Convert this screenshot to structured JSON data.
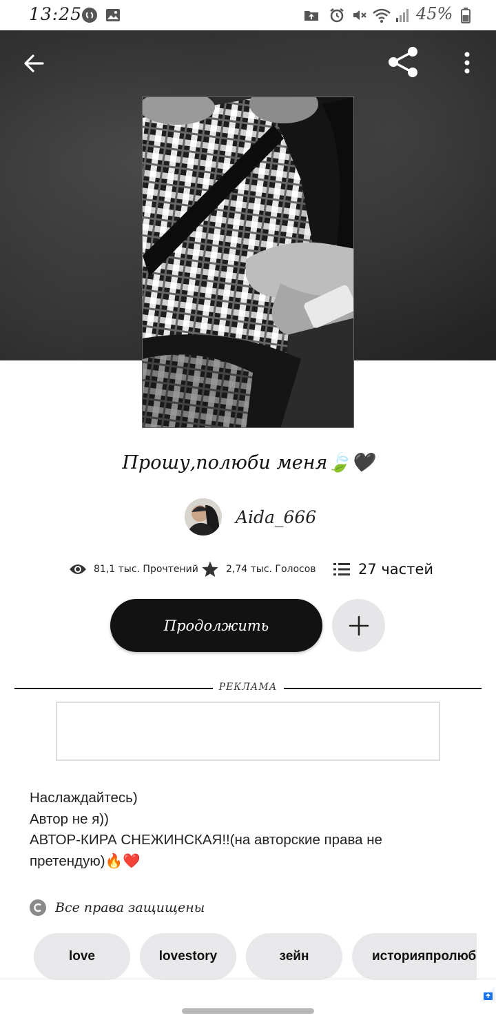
{
  "status_bar": {
    "time": "13:25",
    "battery": "45%",
    "left_icons": [
      "shazam-icon",
      "image-icon"
    ],
    "right_icons": [
      "upload-icon",
      "alarm-icon",
      "mute-icon",
      "wifi-icon",
      "signal-icon",
      "battery-icon"
    ]
  },
  "header": {
    "back_icon": "back-arrow-icon",
    "share_icon": "share-icon",
    "menu_icon": "more-vert-icon"
  },
  "story": {
    "title": "Прошу,полюби меня🍃🖤",
    "author": "Aida_666",
    "reads": "81,1 тыс. Прочтений",
    "votes": "2,74 тыс. Голосов",
    "parts": "27 частей",
    "continue_label": "Продолжить",
    "ad_label": "РЕКЛАМА",
    "description": [
      "Наслаждайтесь)",
      "Автор не я))",
      "АВТОР-КИРА СНЕЖИНСКАЯ!!(на авторские права не",
      "претендую)🔥❤️"
    ],
    "copyright": "Все права защищены",
    "tags": [
      "love",
      "lovestory",
      "зейн",
      "историяпролюбовь"
    ]
  },
  "colors": {
    "primary_button": "#121212",
    "secondary_button": "#e6e6e8",
    "tag_background": "#e8e8ea",
    "cover_background": "#333333"
  }
}
